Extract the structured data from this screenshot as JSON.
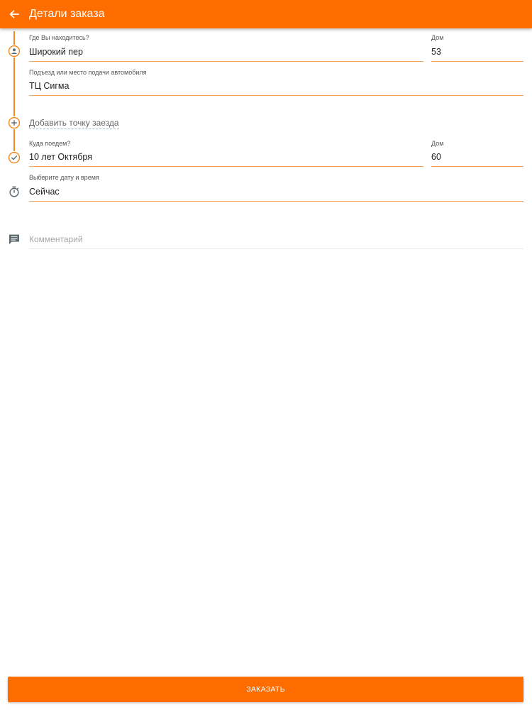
{
  "appbar": {
    "title": "Детали заказа",
    "back_icon": "arrow-left-icon",
    "color": "#ff6d00"
  },
  "pickup": {
    "icon": "person-icon",
    "address_label": "Где Вы находитесь?",
    "address_value": "Широкий пер",
    "house_label": "Дом",
    "house_value": "53",
    "entrance_label": "Подъезд или место подачи автомобиля",
    "entrance_value": "ТЦ Сигма"
  },
  "add_stop": {
    "icon": "add-circle-icon",
    "label": "Добавить точку заезда"
  },
  "destination": {
    "icon": "check-circle-icon",
    "address_label": "Куда поедем?",
    "address_value": "10 лет Октября",
    "house_label": "Дом",
    "house_value": "60"
  },
  "datetime": {
    "icon": "timer-icon",
    "label": "Выберите дату и время",
    "value": "Сейчас"
  },
  "comment": {
    "icon": "comment-icon",
    "placeholder": "Комментарий"
  },
  "order_button": {
    "label": "ЗАКАЗАТЬ"
  },
  "colors": {
    "accent": "#ff6d00",
    "rail": "#f28b22",
    "underline": "#f2a25b",
    "icon_gray": "#5f6b73"
  }
}
